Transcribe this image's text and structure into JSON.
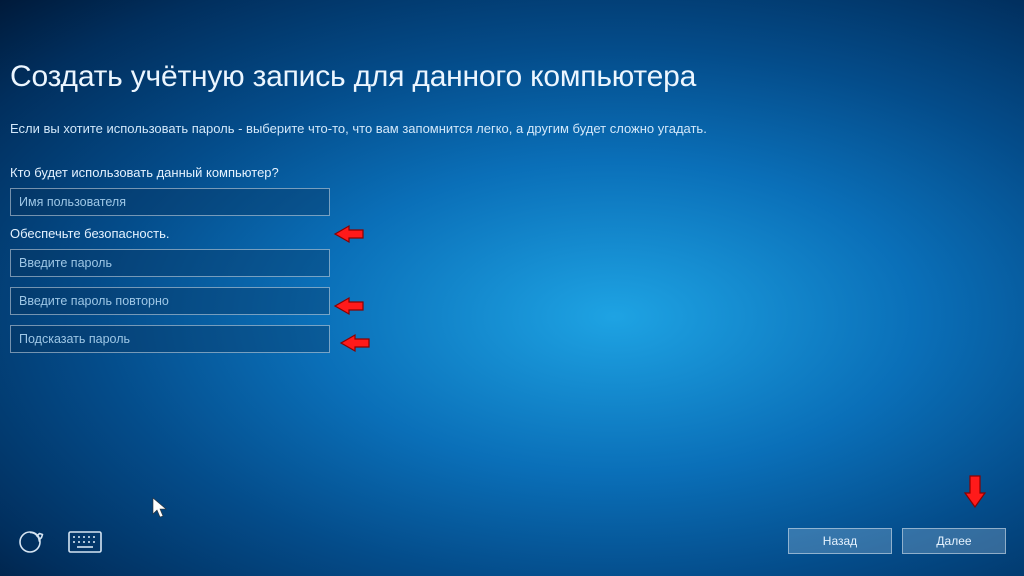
{
  "title": "Создать учётную запись для данного компьютера",
  "subtitle": "Если вы хотите использовать пароль - выберите что-то, что вам запомнится легко, а другим будет сложно угадать.",
  "section_user": "Кто будет использовать данный компьютер?",
  "section_security": "Обеспечьте безопасность.",
  "fields": {
    "username": {
      "placeholder": "Имя пользователя",
      "value": ""
    },
    "password": {
      "placeholder": "Введите пароль",
      "value": ""
    },
    "password_confirm": {
      "placeholder": "Введите пароль повторно",
      "value": ""
    },
    "password_hint": {
      "placeholder": "Подсказать пароль",
      "value": ""
    }
  },
  "buttons": {
    "back": "Назад",
    "next": "Далее"
  },
  "icons": {
    "ease_of_access": "ease-of-access-icon",
    "keyboard": "keyboard-icon"
  }
}
